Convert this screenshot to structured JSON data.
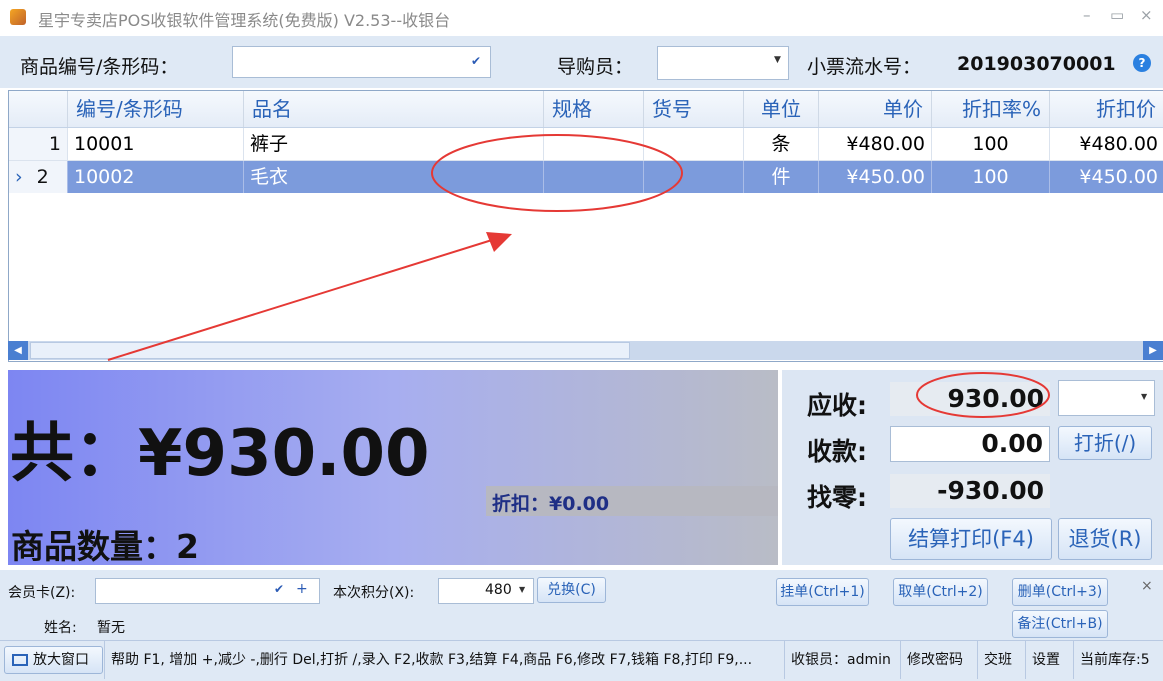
{
  "window": {
    "title": "星宇专卖店POS收银软件管理系统(免费版) V2.53--收银台",
    "minimize": "–",
    "maximize": "▭",
    "close": "×"
  },
  "topbar": {
    "barcode_label": "商品编号/条形码：",
    "guide_label": "导购员：",
    "ticket_label": "小票流水号：",
    "ticket_no": "201903070001"
  },
  "grid": {
    "headers": [
      "编号/条形码",
      "品名",
      "规格",
      "货号",
      "单位",
      "单价",
      "折扣率%",
      "折扣价"
    ],
    "rows": [
      {
        "num": "1",
        "marker": "",
        "code": "10001",
        "name": "裤子",
        "spec": "",
        "item_no": "",
        "unit": "条",
        "price": "¥480.00",
        "rate": "100",
        "disc_price": "¥480.00"
      },
      {
        "num": "2",
        "marker": "›",
        "code": "10002",
        "name": "毛衣",
        "spec": "",
        "item_no": "",
        "unit": "件",
        "price": "¥450.00",
        "rate": "100",
        "disc_price": "¥450.00"
      }
    ]
  },
  "summary": {
    "total_label": "共：",
    "total_value": "¥930.00",
    "discount_label": "折扣：",
    "discount_value": "¥0.00",
    "count_label": "商品数量：",
    "count_value": "2"
  },
  "payment": {
    "receivable_label": "应收:",
    "receivable_value": "930.00",
    "received_label": "收款:",
    "received_value": "0.00",
    "change_label": "找零:",
    "change_value": "-930.00",
    "discount_btn": "打折(/)",
    "checkout_btn": "结算打印(F4)",
    "return_btn": "退货(R)"
  },
  "member": {
    "card_label": "会员卡(Z):",
    "points_label": "本次积分(X):",
    "points_value": "480",
    "exchange_btn": "兑换(C)",
    "name_label": "姓名:",
    "name_value": "暂无",
    "hold_btn": "挂单(Ctrl+1)",
    "retrieve_btn": "取单(Ctrl+2)",
    "delete_btn": "删单(Ctrl+3)",
    "note_btn": "备注(Ctrl+B)",
    "close": "×"
  },
  "statusbar": {
    "enlarge": "放大窗口",
    "help": "帮助 F1, 增加 +,减少 -,删行 Del,打折 /,录入 F2,收款 F3,结算 F4,商品 F6,修改 F7,钱箱 F8,打印 F9,...",
    "cashier": "收银员：admin",
    "change_pwd": "修改密码",
    "shift": "交班",
    "settings": "设置",
    "stock": "当前库存:5"
  },
  "colors": {
    "accent": "#2a63b8",
    "selected_row": "#7c9bdc",
    "annotation": "#e53935"
  }
}
